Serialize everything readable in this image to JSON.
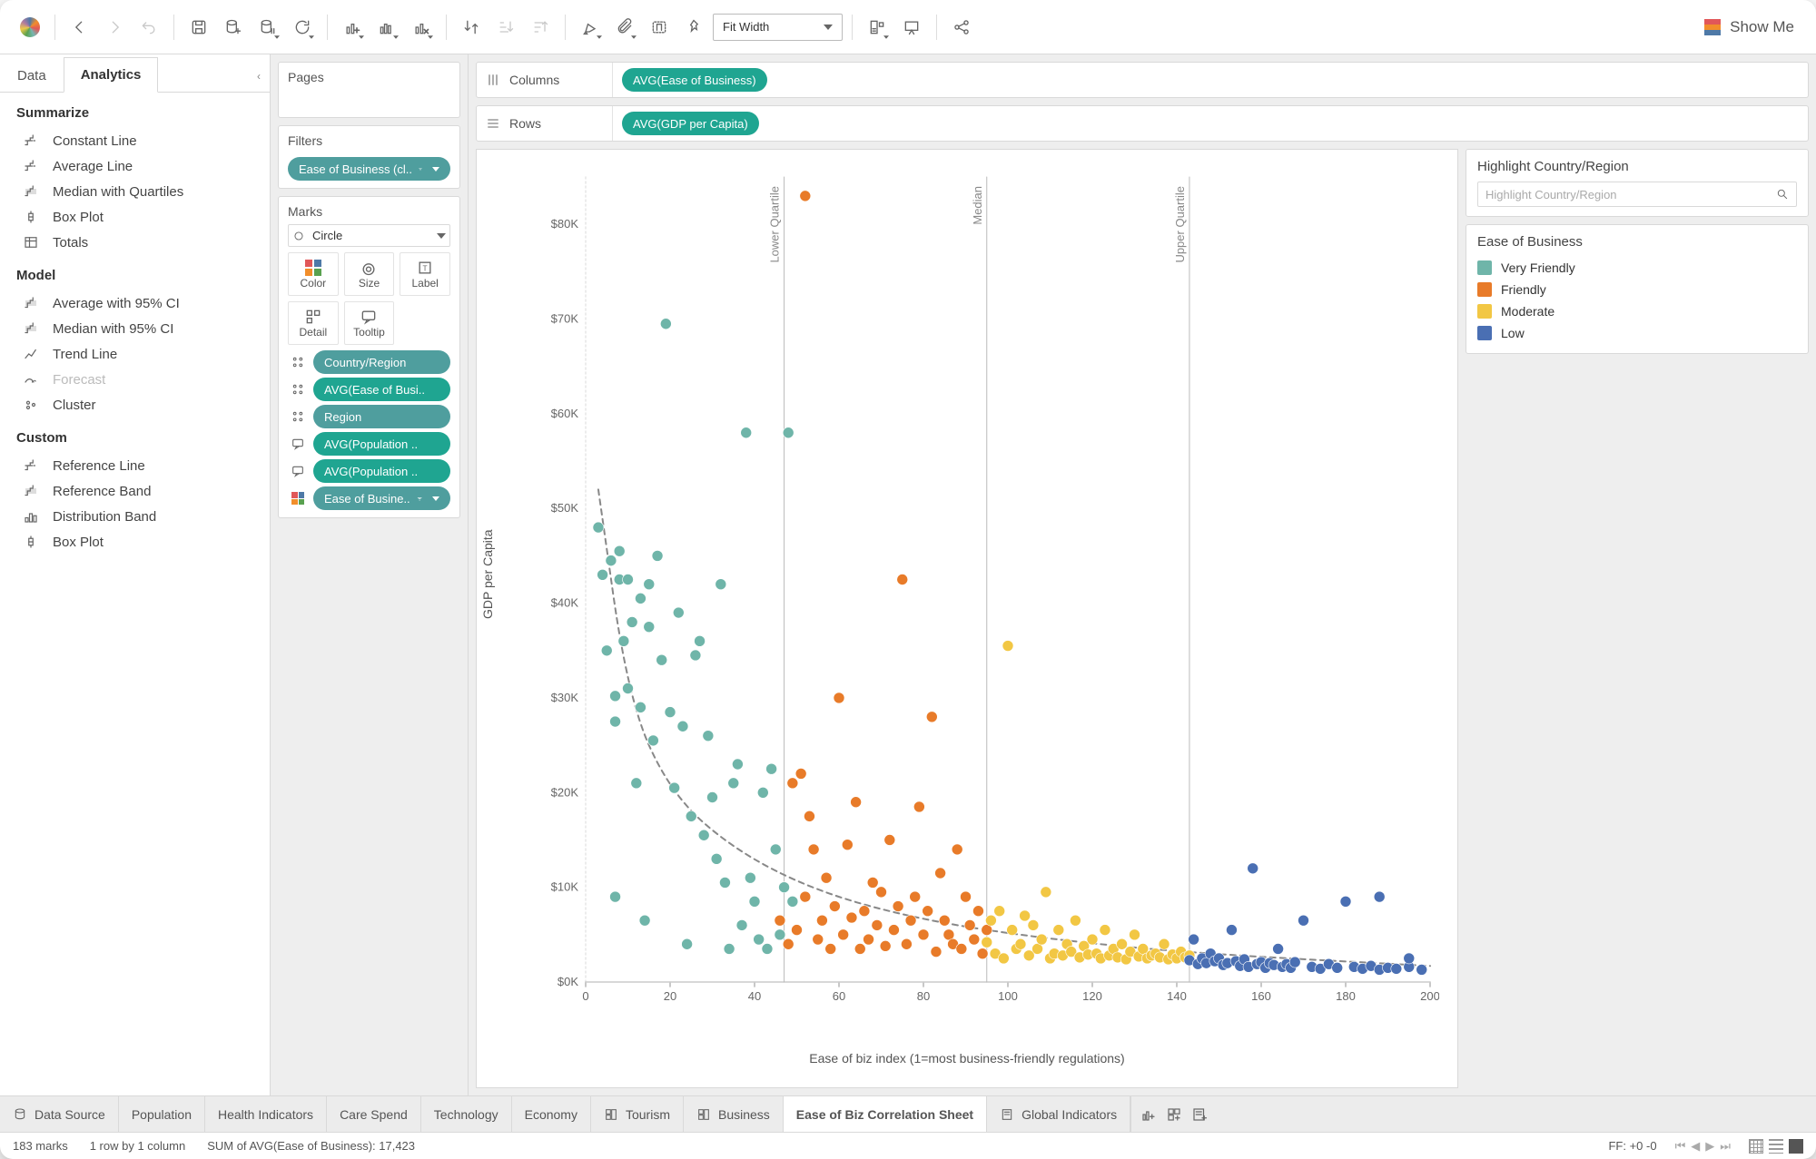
{
  "toolbar": {
    "fit_mode": "Fit Width",
    "show_me": "Show Me"
  },
  "side": {
    "tabs": {
      "data": "Data",
      "analytics": "Analytics"
    },
    "summarize_title": "Summarize",
    "summarize": [
      "Constant Line",
      "Average Line",
      "Median with Quartiles",
      "Box Plot",
      "Totals"
    ],
    "model_title": "Model",
    "model": [
      "Average with 95% CI",
      "Median with 95% CI",
      "Trend Line",
      "Forecast",
      "Cluster"
    ],
    "model_disabled_index": 3,
    "custom_title": "Custom",
    "custom": [
      "Reference Line",
      "Reference Band",
      "Distribution Band",
      "Box Plot"
    ]
  },
  "cards": {
    "pages_title": "Pages",
    "filters_title": "Filters",
    "filter_pill": "Ease of Business (cl..",
    "marks_title": "Marks",
    "mark_type": "Circle",
    "marks_cells": [
      "Color",
      "Size",
      "Label",
      "Detail",
      "Tooltip"
    ],
    "encodings": [
      {
        "lead": "detail",
        "color": "cyan",
        "label": "Country/Region"
      },
      {
        "lead": "detail",
        "color": "teal",
        "label": "AVG(Ease of Busi.."
      },
      {
        "lead": "detail",
        "color": "cyan",
        "label": "Region"
      },
      {
        "lead": "tooltip",
        "color": "teal",
        "label": "AVG(Population .."
      },
      {
        "lead": "tooltip",
        "color": "teal",
        "label": "AVG(Population .."
      },
      {
        "lead": "color",
        "color": "cyan",
        "label": "Ease of Busine.."
      }
    ]
  },
  "shelves": {
    "columns_label": "Columns",
    "columns_pill": "AVG(Ease of Business)",
    "rows_label": "Rows",
    "rows_pill": "AVG(GDP per Capita)"
  },
  "highlight": {
    "title": "Highlight Country/Region",
    "placeholder": "Highlight Country/Region"
  },
  "legend": {
    "title": "Ease of Business",
    "items": [
      {
        "label": "Very Friendly",
        "color": "#6fb5a9"
      },
      {
        "label": "Friendly",
        "color": "#e87b29"
      },
      {
        "label": "Moderate",
        "color": "#f2c744"
      },
      {
        "label": "Low",
        "color": "#4a6fb3"
      }
    ]
  },
  "sheets": {
    "data_source": "Data Source",
    "tabs": [
      "Population",
      "Health Indicators",
      "Care Spend",
      "Technology",
      "Economy",
      "Tourism",
      "Business",
      "Ease of Biz Correlation Sheet",
      "Global Indicators"
    ],
    "active_index": 7,
    "special_icons": {
      "5": "sheet",
      "6": "sheet",
      "8": "story"
    }
  },
  "status": {
    "marks": "183 marks",
    "dims": "1 row by 1 column",
    "sum": "SUM of AVG(Ease of Business): 17,423",
    "ff": "FF: +0 -0"
  },
  "chart_data": {
    "type": "scatter",
    "xlabel": "Ease of biz index (1=most business-friendly regulations)",
    "ylabel": "GDP per Capita",
    "xlim": [
      0,
      200
    ],
    "ylim": [
      0,
      85000
    ],
    "x_ticks": [
      0,
      20,
      40,
      60,
      80,
      100,
      120,
      140,
      160,
      180,
      200
    ],
    "y_ticks": [
      0,
      10000,
      20000,
      30000,
      40000,
      50000,
      60000,
      70000,
      80000
    ],
    "reference_lines": [
      {
        "kind": "vertical",
        "x": 47,
        "label": "Lower Quartile"
      },
      {
        "kind": "vertical",
        "x": 95,
        "label": "Median"
      },
      {
        "kind": "vertical",
        "x": 143,
        "label": "Upper Quartile"
      }
    ],
    "trend": {
      "shape": "power",
      "from_x": 3,
      "to_x": 200
    },
    "series": [
      {
        "name": "Very Friendly",
        "color": "#6fb5a9",
        "points": [
          [
            3,
            48000
          ],
          [
            4,
            43000
          ],
          [
            5,
            35000
          ],
          [
            6,
            44500
          ],
          [
            7,
            27500
          ],
          [
            7,
            30200
          ],
          [
            7,
            9000
          ],
          [
            8,
            42500
          ],
          [
            8,
            45500
          ],
          [
            9,
            36000
          ],
          [
            10,
            42500
          ],
          [
            10,
            31000
          ],
          [
            11,
            38000
          ],
          [
            12,
            21000
          ],
          [
            13,
            40500
          ],
          [
            13,
            29000
          ],
          [
            14,
            6500
          ],
          [
            15,
            42000
          ],
          [
            15,
            37500
          ],
          [
            16,
            25500
          ],
          [
            17,
            45000
          ],
          [
            18,
            34000
          ],
          [
            19,
            69500
          ],
          [
            20,
            28500
          ],
          [
            21,
            20500
          ],
          [
            22,
            39000
          ],
          [
            23,
            27000
          ],
          [
            24,
            4000
          ],
          [
            25,
            17500
          ],
          [
            26,
            34500
          ],
          [
            27,
            36000
          ],
          [
            28,
            15500
          ],
          [
            29,
            26000
          ],
          [
            30,
            19500
          ],
          [
            31,
            13000
          ],
          [
            32,
            42000
          ],
          [
            33,
            10500
          ],
          [
            34,
            3500
          ],
          [
            35,
            21000
          ],
          [
            36,
            23000
          ],
          [
            37,
            6000
          ],
          [
            38,
            58000
          ],
          [
            39,
            11000
          ],
          [
            40,
            8500
          ],
          [
            41,
            4500
          ],
          [
            42,
            20000
          ],
          [
            43,
            3500
          ],
          [
            44,
            22500
          ],
          [
            45,
            14000
          ],
          [
            46,
            5000
          ],
          [
            47,
            10000
          ],
          [
            48,
            58000
          ],
          [
            49,
            8500
          ]
        ]
      },
      {
        "name": "Friendly",
        "color": "#e87b29",
        "points": [
          [
            46,
            6500
          ],
          [
            48,
            4000
          ],
          [
            49,
            21000
          ],
          [
            50,
            5500
          ],
          [
            51,
            22000
          ],
          [
            52,
            9000
          ],
          [
            52,
            83000
          ],
          [
            53,
            17500
          ],
          [
            54,
            14000
          ],
          [
            55,
            4500
          ],
          [
            56,
            6500
          ],
          [
            57,
            11000
          ],
          [
            58,
            3500
          ],
          [
            59,
            8000
          ],
          [
            60,
            30000
          ],
          [
            61,
            5000
          ],
          [
            62,
            14500
          ],
          [
            63,
            6800
          ],
          [
            64,
            19000
          ],
          [
            65,
            3500
          ],
          [
            66,
            7500
          ],
          [
            67,
            4500
          ],
          [
            68,
            10500
          ],
          [
            69,
            6000
          ],
          [
            70,
            9500
          ],
          [
            71,
            3800
          ],
          [
            72,
            15000
          ],
          [
            73,
            5500
          ],
          [
            74,
            8000
          ],
          [
            75,
            42500
          ],
          [
            76,
            4000
          ],
          [
            77,
            6500
          ],
          [
            78,
            9000
          ],
          [
            79,
            18500
          ],
          [
            80,
            5000
          ],
          [
            81,
            7500
          ],
          [
            82,
            28000
          ],
          [
            83,
            3200
          ],
          [
            84,
            11500
          ],
          [
            85,
            6500
          ],
          [
            86,
            5000
          ],
          [
            87,
            4000
          ],
          [
            88,
            14000
          ],
          [
            89,
            3500
          ],
          [
            90,
            9000
          ],
          [
            91,
            6000
          ],
          [
            92,
            4500
          ],
          [
            93,
            7500
          ],
          [
            94,
            3000
          ],
          [
            95,
            5500
          ]
        ]
      },
      {
        "name": "Moderate",
        "color": "#f2c744",
        "points": [
          [
            95,
            4200
          ],
          [
            96,
            6500
          ],
          [
            97,
            3000
          ],
          [
            98,
            7500
          ],
          [
            99,
            2500
          ],
          [
            100,
            35500
          ],
          [
            101,
            5500
          ],
          [
            102,
            3500
          ],
          [
            103,
            4000
          ],
          [
            104,
            7000
          ],
          [
            105,
            2800
          ],
          [
            106,
            6000
          ],
          [
            107,
            3500
          ],
          [
            108,
            4500
          ],
          [
            109,
            9500
          ],
          [
            110,
            2500
          ],
          [
            111,
            3000
          ],
          [
            112,
            5500
          ],
          [
            113,
            2800
          ],
          [
            114,
            4000
          ],
          [
            115,
            3200
          ],
          [
            116,
            6500
          ],
          [
            117,
            2600
          ],
          [
            118,
            3800
          ],
          [
            119,
            2900
          ],
          [
            120,
            4500
          ],
          [
            121,
            3000
          ],
          [
            122,
            2500
          ],
          [
            123,
            5500
          ],
          [
            124,
            2800
          ],
          [
            125,
            3500
          ],
          [
            126,
            2600
          ],
          [
            127,
            4000
          ],
          [
            128,
            2400
          ],
          [
            129,
            3200
          ],
          [
            130,
            5000
          ],
          [
            131,
            2700
          ],
          [
            132,
            3500
          ],
          [
            133,
            2500
          ],
          [
            134,
            2800
          ],
          [
            135,
            3000
          ],
          [
            136,
            2600
          ],
          [
            137,
            4000
          ],
          [
            138,
            2400
          ],
          [
            139,
            2900
          ],
          [
            140,
            2500
          ],
          [
            141,
            3200
          ],
          [
            142,
            2600
          ],
          [
            143,
            2800
          ]
        ]
      },
      {
        "name": "Low",
        "color": "#4a6fb3",
        "points": [
          [
            143,
            2300
          ],
          [
            144,
            4500
          ],
          [
            145,
            1900
          ],
          [
            146,
            2500
          ],
          [
            147,
            2000
          ],
          [
            148,
            3000
          ],
          [
            149,
            2200
          ],
          [
            150,
            2500
          ],
          [
            151,
            1800
          ],
          [
            152,
            2000
          ],
          [
            153,
            5500
          ],
          [
            154,
            2200
          ],
          [
            155,
            1700
          ],
          [
            156,
            2400
          ],
          [
            157,
            1600
          ],
          [
            158,
            12000
          ],
          [
            159,
            1900
          ],
          [
            160,
            2100
          ],
          [
            161,
            1500
          ],
          [
            162,
            2000
          ],
          [
            163,
            1800
          ],
          [
            164,
            3500
          ],
          [
            165,
            1600
          ],
          [
            166,
            1900
          ],
          [
            167,
            1500
          ],
          [
            168,
            2100
          ],
          [
            170,
            6500
          ],
          [
            172,
            1600
          ],
          [
            174,
            1400
          ],
          [
            176,
            1900
          ],
          [
            178,
            1500
          ],
          [
            180,
            8500
          ],
          [
            182,
            1600
          ],
          [
            184,
            1400
          ],
          [
            186,
            1700
          ],
          [
            188,
            1300
          ],
          [
            190,
            1500
          ],
          [
            192,
            1400
          ],
          [
            195,
            1600
          ],
          [
            198,
            1300
          ],
          [
            188,
            9000
          ],
          [
            195,
            2500
          ]
        ]
      }
    ]
  }
}
